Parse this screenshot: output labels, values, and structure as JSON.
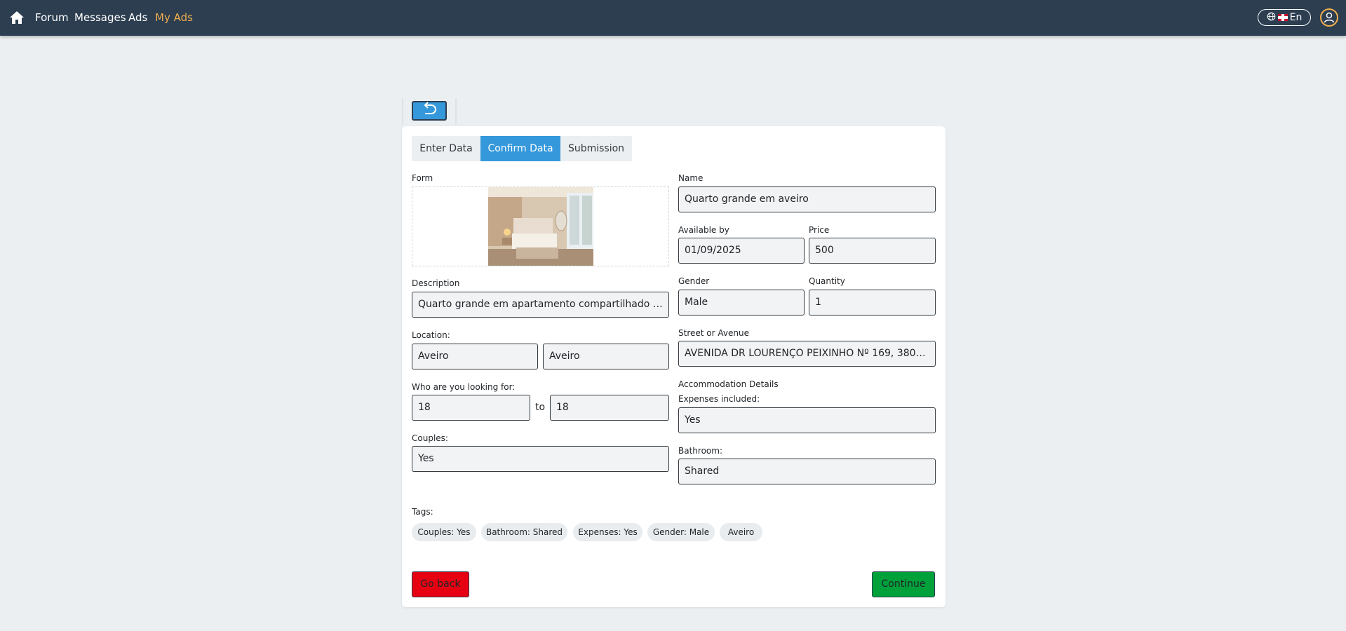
{
  "nav": {
    "links": [
      "Forum",
      "Messages",
      "Ads",
      "My Ads"
    ],
    "language": "En"
  },
  "tabs": [
    "Enter Data",
    "Confirm Data",
    "Submission"
  ],
  "form": {
    "photo_label": "Form",
    "name_label": "Name",
    "name_value": "Quarto grande em aveiro",
    "available_label": "Available by",
    "available_value": "01/09/2025",
    "price_label": "Price",
    "price_value": "500",
    "description_label": "Description",
    "description_value": "Quarto grande em apartamento compartilhado com…",
    "gender_label": "Gender",
    "gender_value": "Male",
    "quantity_label": "Quantity",
    "quantity_value": "1",
    "location_label": "Location:",
    "location_district": "Aveiro",
    "location_city": "Aveiro",
    "street_label": "Street or Avenue",
    "street_value": "AVENIDA DR LOURENÇO PEIXINHO Nº 169, 3800-99…",
    "looking_label": "Who are you looking for:",
    "age_from": "18",
    "age_to_text": "to",
    "age_to": "18",
    "accommodation_label": "Accommodation Details",
    "expenses_label": "Expenses included:",
    "expenses_value": "Yes",
    "couples_label": "Couples:",
    "couples_value": "Yes",
    "bathroom_label": "Bathroom:",
    "bathroom_value": "Shared"
  },
  "tags_label": "Tags:",
  "tags": [
    "Couples: Yes",
    "Bathroom: Shared",
    "Expenses: Yes",
    "Gender: Male",
    "Aveiro"
  ],
  "buttons": {
    "go_back": "Go back",
    "continue": "Continue"
  },
  "icons": {
    "home": "home-icon",
    "globe": "globe-icon",
    "flag": "uk-flag-icon",
    "user": "user-circle-icon",
    "undo": "undo-arrow-icon"
  },
  "colors": {
    "navbar": "#2c3e50",
    "active_nav": "#f0ad4e",
    "primary": "#3498db",
    "danger": "#e60012",
    "success": "#00a13a"
  }
}
